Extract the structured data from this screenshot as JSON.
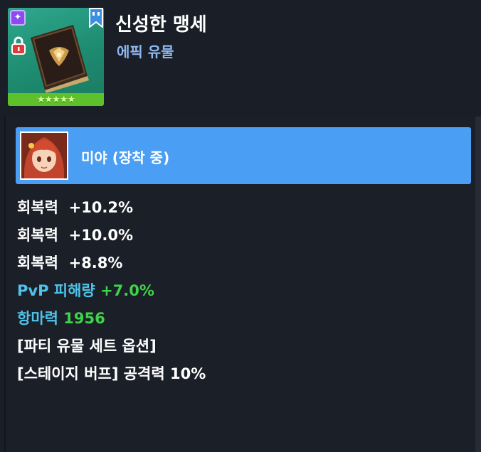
{
  "item": {
    "name": "신성한 맹세",
    "grade_label": "에픽 유물",
    "stars": "★★★★★",
    "grade_icon": "sparkle-grade-icon",
    "lock_icon": "lock-icon",
    "bookmark_icon": "bookmark-icon"
  },
  "equipped": {
    "label": "미야 (장착 중)",
    "bar_color": "#4a9ef3"
  },
  "stats": [
    {
      "name": "회복력",
      "value": "+10.2%"
    },
    {
      "name": "회복력",
      "value": "+10.0%"
    },
    {
      "name": "회복력",
      "value": "+8.8%"
    },
    {
      "name": "PvP 피해량",
      "value": "+7.0%"
    },
    {
      "name": "항마력",
      "value": "1956"
    },
    {
      "name": "[파티 유물 세트 옵션]",
      "value": ""
    },
    {
      "name": "[스테이지 버프] 공격력",
      "value": "10%"
    }
  ],
  "colors": {
    "accent_cyan": "#4fc3ea",
    "accent_green": "#40d24a",
    "background": "#1a1e27"
  }
}
